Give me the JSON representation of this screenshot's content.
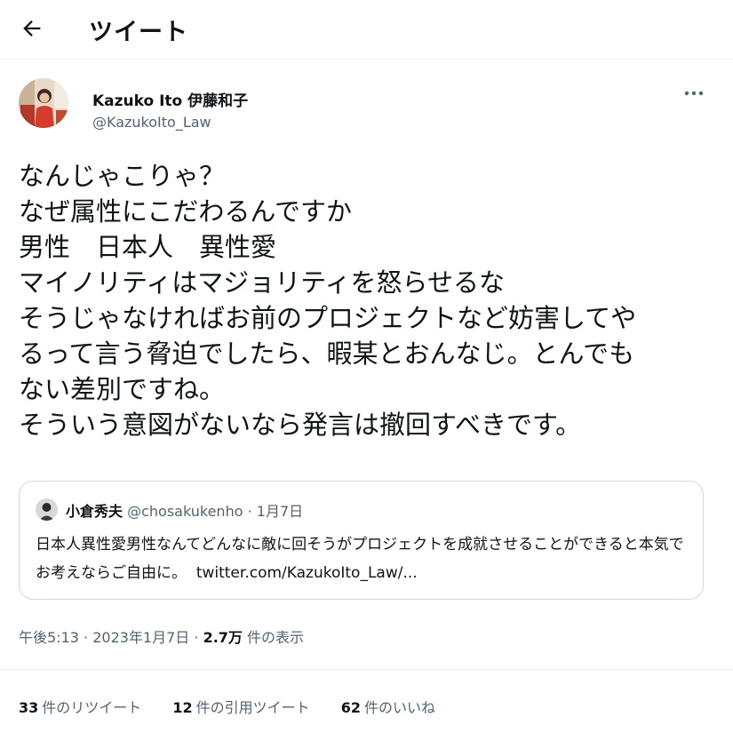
{
  "header": {
    "title": "ツイート",
    "back_icon": "arrow-left-icon"
  },
  "author": {
    "display_name": "Kazuko Ito 伊藤和子",
    "handle": "@KazukoIto_Law",
    "more_icon": "more-horizontal-icon"
  },
  "tweet": {
    "text": "なんじゃこりゃ？\nなぜ属性にこだわるんですか\n男性　日本人　異性愛\nマイノリティはマジョリティを怒らせるな\nそうじゃなければお前のプロジェクトなど妨害してや\nるって言う脅迫でしたら、暇某とおんなじ。とんでも\nない差別ですね。\nそういう意図がないなら発言は撤回すべきです。"
  },
  "quote": {
    "name": "小倉秀夫",
    "handle": "@chosakukenho",
    "separator": "·",
    "date": "1月7日",
    "text": "日本人異性愛男性なんてどんなに敵に回そうがプロジェクトを成就させることができると本気でお考えならご自由に。",
    "link": "twitter.com/KazukoIto_Law/..."
  },
  "meta": {
    "time": "午後5:13",
    "date": "2023年1月7日",
    "views_count": "2.7万",
    "views_label": "件の表示"
  },
  "stats": [
    {
      "count": "33",
      "label": "件のリツイート"
    },
    {
      "count": "12",
      "label": "件の引用ツイート"
    },
    {
      "count": "62",
      "label": "件のいいね"
    }
  ],
  "colors": {
    "text": "#0f1419",
    "secondary": "#536471",
    "border": "#cfd9de",
    "divider": "#eff3f4"
  }
}
